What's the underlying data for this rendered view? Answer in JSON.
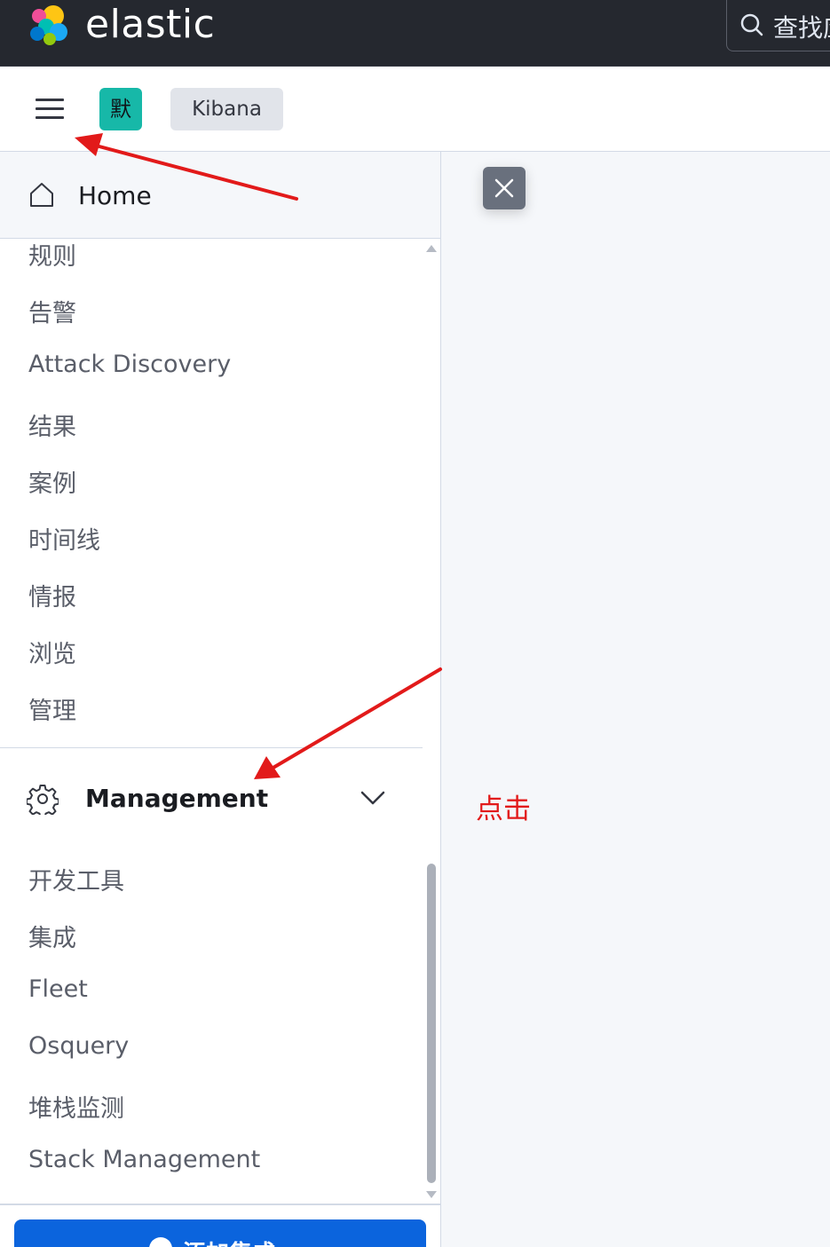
{
  "header": {
    "brand": "elastic",
    "search_placeholder": "查找应"
  },
  "subbar": {
    "space_initial": "默",
    "breadcrumb": "Kibana"
  },
  "sidenav": {
    "home_label": "Home",
    "items": [
      "规则",
      "告警",
      "Attack Discovery",
      "结果",
      "案例",
      "时间线",
      "情报",
      "浏览",
      "管理"
    ],
    "management": {
      "label": "Management",
      "items": [
        "开发工具",
        "集成",
        "Fleet",
        "Osquery",
        "堆栈监测",
        "Stack Management"
      ]
    },
    "add_button": "添加集成"
  },
  "annotation": {
    "click_note": "点击",
    "color": "#e21a1a"
  },
  "colors": {
    "topbar": "#25282f",
    "accent": "#17b8a8",
    "primary_button": "#0b64dd"
  }
}
